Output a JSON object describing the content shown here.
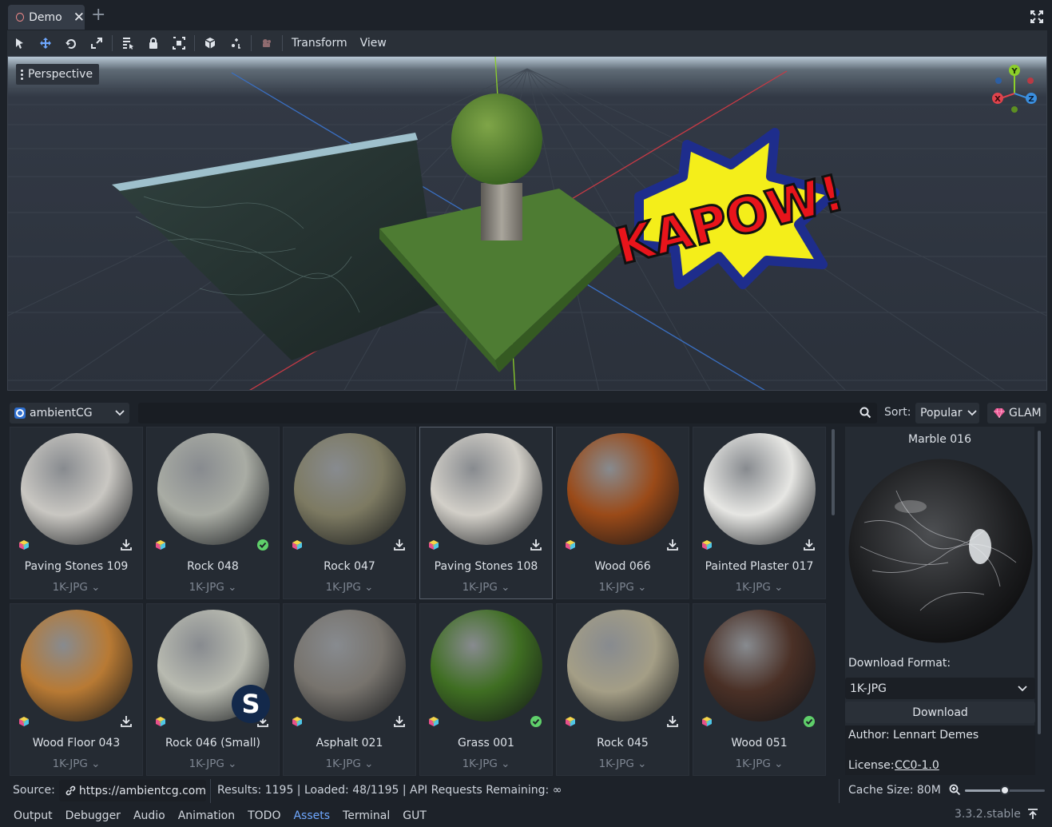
{
  "window": {
    "tab_title": "Demo"
  },
  "toolbar": {
    "menus": [
      "Transform",
      "View"
    ]
  },
  "viewport": {
    "mode_label": "Perspective",
    "overlay_text": "KAPOW!",
    "gizmo_axes": [
      "Y",
      "X",
      "Z"
    ]
  },
  "assets": {
    "source": "ambientCG",
    "search_placeholder": "",
    "sort_label": "Sort:",
    "sort_value": "Popular",
    "glam_label": "GLAM",
    "items": [
      {
        "name": "Paving Stones 109",
        "format": "1K-JPG",
        "status": "download",
        "color": "#c9c7c2"
      },
      {
        "name": "Rock 048",
        "format": "1K-JPG",
        "status": "installed",
        "color": "#a9aca4"
      },
      {
        "name": "Rock 047",
        "format": "1K-JPG",
        "status": "download",
        "color": "#7d7a62"
      },
      {
        "name": "Paving Stones 108",
        "format": "1K-JPG",
        "status": "download",
        "color": "#d2cfc8"
      },
      {
        "name": "Wood 066",
        "format": "1K-JPG",
        "status": "download",
        "color": "#9a4a18"
      },
      {
        "name": "Painted Plaster 017",
        "format": "1K-JPG",
        "status": "download",
        "color": "#e6e6e3"
      },
      {
        "name": "Wood Floor 043",
        "format": "1K-JPG",
        "status": "download",
        "color": "#b87a34"
      },
      {
        "name": "Rock 046 (Small)",
        "format": "1K-JPG",
        "status": "download",
        "color": "#b8bab0"
      },
      {
        "name": "Asphalt 021",
        "format": "1K-JPG",
        "status": "download",
        "color": "#77736d"
      },
      {
        "name": "Grass 001",
        "format": "1K-JPG",
        "status": "installed",
        "color": "#3f6e22"
      },
      {
        "name": "Rock 045",
        "format": "1K-JPG",
        "status": "download",
        "color": "#a49e86"
      },
      {
        "name": "Wood 051",
        "format": "1K-JPG",
        "status": "installed",
        "color": "#4a3026"
      }
    ],
    "preview": {
      "title": "Marble 016",
      "format_label": "Download Format:",
      "format_value": "1K-JPG",
      "download_label": "Download",
      "author": "Author: Lennart Demes",
      "license_label": "License:",
      "license_value": "CC0-1.0"
    }
  },
  "status": {
    "source_label": "Source:",
    "source_url": "https://ambientcg.com",
    "results": "Results: 1195 | Loaded: 48/1195 | API Requests Remaining: ∞",
    "cache": "Cache Size: 80M",
    "zoom_level": 0.5
  },
  "bottom_tabs": [
    "Output",
    "Debugger",
    "Audio",
    "Animation",
    "TODO",
    "Assets",
    "Terminal",
    "GUT"
  ],
  "active_bottom_tab": "Assets",
  "version": "3.3.2.stable",
  "colors": {
    "accent": "#6fa8ff",
    "installed": "#5fcf6a",
    "panel": "#252b33"
  }
}
